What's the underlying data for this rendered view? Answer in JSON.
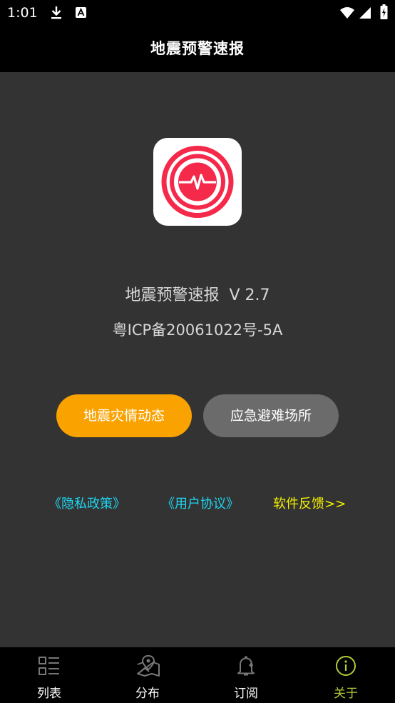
{
  "status_bar": {
    "time": "1:01",
    "icons": [
      "download-icon",
      "a-icon",
      "wifi-icon",
      "signal-icon",
      "battery-icon"
    ]
  },
  "app_bar": {
    "title": "地震预警速报"
  },
  "about": {
    "app_name": "地震预警速报",
    "version": "V 2.7",
    "icp": "粤ICP备20061022号-5A"
  },
  "buttons": {
    "disaster_news": "地震灾情动态",
    "shelters": "应急避难场所"
  },
  "links": {
    "privacy": "《隐私政策》",
    "agreement": "《用户协议》",
    "feedback": "软件反馈>>"
  },
  "tabs": [
    {
      "label": "列表",
      "icon": "list-icon",
      "active": false
    },
    {
      "label": "分布",
      "icon": "map-icon",
      "active": false
    },
    {
      "label": "订阅",
      "icon": "bell-icon",
      "active": false
    },
    {
      "label": "关于",
      "icon": "info-icon",
      "active": true
    }
  ],
  "colors": {
    "background": "#333333",
    "bar": "#000000",
    "accent_orange": "#f9a200",
    "button_gray": "#6b6b6b",
    "link_cyan": "#1ed6f2",
    "link_yellow": "#f4f000",
    "tab_active": "#b2c93a",
    "logo_red": "#f5294a"
  }
}
